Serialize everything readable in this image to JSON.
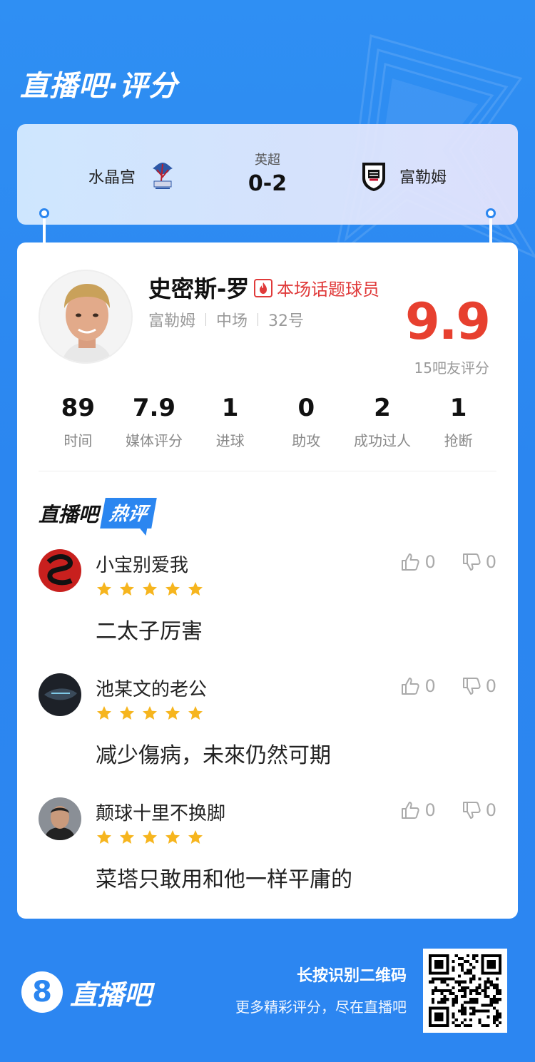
{
  "header": {
    "title": "直播吧·评分"
  },
  "match": {
    "home_team": "水晶宫",
    "away_team": "富勒姆",
    "league": "英超",
    "score": "0-2"
  },
  "player": {
    "name": "史密斯-罗",
    "badge": "本场话题球员",
    "team": "富勒姆",
    "position": "中场",
    "number": "32号",
    "rating": "9.9",
    "rating_count": "15吧友评分"
  },
  "stats": [
    {
      "value": "89",
      "label": "时间"
    },
    {
      "value": "7.9",
      "label": "媒体评分"
    },
    {
      "value": "1",
      "label": "进球"
    },
    {
      "value": "0",
      "label": "助攻"
    },
    {
      "value": "2",
      "label": "成功过人"
    },
    {
      "value": "1",
      "label": "抢断"
    }
  ],
  "hot_comments": {
    "title": "直播吧",
    "tag": "热评",
    "items": [
      {
        "user": "小宝别爱我",
        "stars": 5,
        "text": "二太子厉害",
        "likes": "0",
        "dislikes": "0"
      },
      {
        "user": "池某文的老公",
        "stars": 5,
        "text": "减少傷病，未來仍然可期",
        "likes": "0",
        "dislikes": "0"
      },
      {
        "user": "颠球十里不换脚",
        "stars": 5,
        "text": "菜塔只敢用和他一样平庸的",
        "likes": "0",
        "dislikes": "0"
      }
    ]
  },
  "footer": {
    "logo_mark": "8",
    "logo_text": "直播吧",
    "line1": "长按识别二维码",
    "line2": "更多精彩评分，尽在直播吧"
  },
  "colors": {
    "brand_blue": "#2b86f0",
    "rating_red": "#e7402f",
    "star_yellow": "#f6b51e"
  }
}
